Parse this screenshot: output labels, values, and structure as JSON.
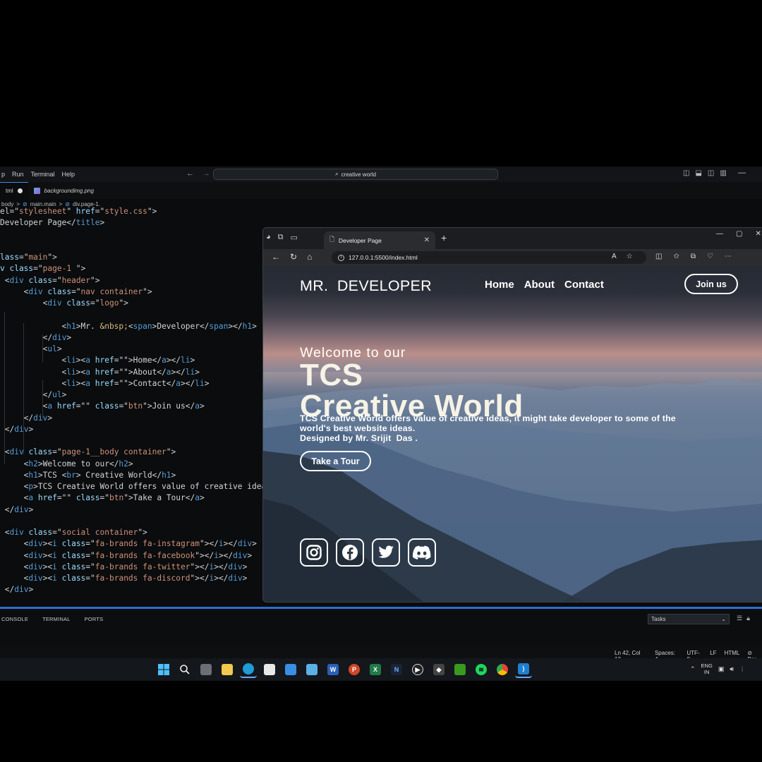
{
  "vscode": {
    "menus": [
      "p",
      "Run",
      "Terminal",
      "Help"
    ],
    "command_center": "creative world",
    "tabs": [
      {
        "label": "tml",
        "modified": true
      },
      {
        "label": "backgroundimg.png"
      }
    ],
    "breadcrumb": [
      "body",
      ">",
      "main.main",
      ">",
      "div.page-1."
    ],
    "panel_tabs": [
      "CONSOLE",
      "TERMINAL",
      "PORTS"
    ],
    "tasks_select": "Tasks",
    "status": {
      "position": "Ln 42, Col 12",
      "spaces": "Spaces: 4",
      "encoding": "UTF-8",
      "eol": "LF",
      "language": "HTML",
      "port": "Por"
    }
  },
  "browser": {
    "tab_title": "Developer Page",
    "url": "127.0.0.1:5500/index.html"
  },
  "site": {
    "logo_left": "MR.",
    "logo_right": "DEVELOPER",
    "nav": [
      "Home",
      "About",
      "Contact"
    ],
    "join_button": "Join us",
    "hero_subtitle": "Welcome to our",
    "hero_title_line1": "TCS",
    "hero_title_line2": "Creative World",
    "hero_paragraph_line1": "TCS Creative World offers value of creative ideas, it might take developer to some of the",
    "hero_paragraph_line2": "world's best website ideas.",
    "hero_paragraph_line3": "Designed by Mr. Srijit  Das .",
    "tour_button": "Take a Tour",
    "social_icons": [
      "instagram-icon",
      "facebook-icon",
      "twitter-icon",
      "discord-icon"
    ]
  },
  "taskbar": {
    "lang_line1": "ENG",
    "lang_line2": "IN"
  },
  "code_lines": [
    [
      [
        "p",
        "el=\""
      ],
      [
        "s",
        "stylesheet"
      ],
      [
        "p",
        "\" "
      ],
      [
        "a",
        "href"
      ],
      [
        "p",
        "=\""
      ],
      [
        "s",
        "style.css"
      ],
      [
        "p",
        "\">"
      ]
    ],
    [
      [
        "p",
        "Developer Page</"
      ],
      [
        "t",
        "title"
      ],
      [
        "p",
        ">"
      ]
    ],
    [],
    [],
    [
      [
        "a",
        "lass"
      ],
      [
        "p",
        "=\""
      ],
      [
        "s",
        "main"
      ],
      [
        "p",
        "\">"
      ]
    ],
    [
      [
        "a",
        "v class"
      ],
      [
        "p",
        "=\""
      ],
      [
        "s",
        "page-1 "
      ],
      [
        "p",
        "\">"
      ]
    ],
    [
      [
        "p",
        " <"
      ],
      [
        "t",
        "div"
      ],
      [
        "a",
        " class"
      ],
      [
        "p",
        "=\""
      ],
      [
        "s",
        "header"
      ],
      [
        "p",
        "\">"
      ]
    ],
    [
      [
        "p",
        "     <"
      ],
      [
        "t",
        "div"
      ],
      [
        "a",
        " class"
      ],
      [
        "p",
        "=\""
      ],
      [
        "s",
        "nav container"
      ],
      [
        "p",
        "\">"
      ]
    ],
    [
      [
        "p",
        "         <"
      ],
      [
        "t",
        "div"
      ],
      [
        "a",
        " class"
      ],
      [
        "p",
        "=\""
      ],
      [
        "s",
        "logo"
      ],
      [
        "p",
        "\">"
      ]
    ],
    [],
    [
      [
        "p",
        "             <"
      ],
      [
        "t",
        "h1"
      ],
      [
        "p",
        ">Mr. "
      ],
      [
        "e",
        "&nbsp;"
      ],
      [
        "p",
        "<"
      ],
      [
        "t",
        "span"
      ],
      [
        "p",
        ">Developer</"
      ],
      [
        "t",
        "span"
      ],
      [
        "p",
        "></"
      ],
      [
        "t",
        "h1"
      ],
      [
        "p",
        ">"
      ]
    ],
    [
      [
        "p",
        "         </"
      ],
      [
        "t",
        "div"
      ],
      [
        "p",
        ">"
      ]
    ],
    [
      [
        "p",
        "         <"
      ],
      [
        "t",
        "ul"
      ],
      [
        "p",
        ">"
      ]
    ],
    [
      [
        "p",
        "             <"
      ],
      [
        "t",
        "li"
      ],
      [
        "p",
        "><"
      ],
      [
        "t",
        "a"
      ],
      [
        "a",
        " href"
      ],
      [
        "p",
        "=\"\">Home</"
      ],
      [
        "t",
        "a"
      ],
      [
        "p",
        "></"
      ],
      [
        "t",
        "li"
      ],
      [
        "p",
        ">"
      ]
    ],
    [
      [
        "p",
        "             <"
      ],
      [
        "t",
        "li"
      ],
      [
        "p",
        "><"
      ],
      [
        "t",
        "a"
      ],
      [
        "a",
        " href"
      ],
      [
        "p",
        "=\"\">About</"
      ],
      [
        "t",
        "a"
      ],
      [
        "p",
        "></"
      ],
      [
        "t",
        "li"
      ],
      [
        "p",
        ">"
      ]
    ],
    [
      [
        "p",
        "             <"
      ],
      [
        "t",
        "li"
      ],
      [
        "p",
        "><"
      ],
      [
        "t",
        "a"
      ],
      [
        "a",
        " href"
      ],
      [
        "p",
        "=\"\">Contact</"
      ],
      [
        "t",
        "a"
      ],
      [
        "p",
        "></"
      ],
      [
        "t",
        "li"
      ],
      [
        "p",
        ">"
      ]
    ],
    [
      [
        "p",
        "         </"
      ],
      [
        "t",
        "ul"
      ],
      [
        "p",
        ">"
      ]
    ],
    [
      [
        "p",
        "         <"
      ],
      [
        "t",
        "a"
      ],
      [
        "a",
        " href"
      ],
      [
        "p",
        "=\"\" "
      ],
      [
        "a",
        "class"
      ],
      [
        "p",
        "=\""
      ],
      [
        "s",
        "btn"
      ],
      [
        "p",
        "\">Join us</"
      ],
      [
        "t",
        "a"
      ],
      [
        "p",
        ">"
      ]
    ],
    [
      [
        "p",
        "     </"
      ],
      [
        "t",
        "div"
      ],
      [
        "p",
        ">"
      ]
    ],
    [
      [
        "p",
        " </"
      ],
      [
        "t",
        "div"
      ],
      [
        "p",
        ">"
      ]
    ],
    [],
    [
      [
        "p",
        " <"
      ],
      [
        "t",
        "div"
      ],
      [
        "a",
        " class"
      ],
      [
        "p",
        "=\""
      ],
      [
        "s",
        "page-1__body container"
      ],
      [
        "p",
        "\">"
      ]
    ],
    [
      [
        "p",
        "     <"
      ],
      [
        "t",
        "h2"
      ],
      [
        "p",
        ">Welcome to our</"
      ],
      [
        "t",
        "h2"
      ],
      [
        "p",
        ">"
      ]
    ],
    [
      [
        "p",
        "     <"
      ],
      [
        "t",
        "h1"
      ],
      [
        "p",
        ">TCS <"
      ],
      [
        "t",
        "br"
      ],
      [
        "p",
        "> Creative World</"
      ],
      [
        "t",
        "h1"
      ],
      [
        "p",
        ">"
      ]
    ],
    [
      [
        "p",
        "     <"
      ],
      [
        "t",
        "p"
      ],
      [
        "p",
        ">TCS Creative World offers value of creative idea"
      ]
    ],
    [
      [
        "p",
        "     <"
      ],
      [
        "t",
        "a"
      ],
      [
        "a",
        " href"
      ],
      [
        "p",
        "=\"\" "
      ],
      [
        "a",
        "class"
      ],
      [
        "p",
        "=\""
      ],
      [
        "s",
        "btn"
      ],
      [
        "p",
        "\">Take a Tour</"
      ],
      [
        "t",
        "a"
      ],
      [
        "p",
        ">"
      ]
    ],
    [
      [
        "p",
        " </"
      ],
      [
        "t",
        "div"
      ],
      [
        "p",
        ">"
      ]
    ],
    [],
    [
      [
        "p",
        " <"
      ],
      [
        "t",
        "div"
      ],
      [
        "a",
        " class"
      ],
      [
        "p",
        "=\""
      ],
      [
        "s",
        "social container"
      ],
      [
        "p",
        "\">"
      ]
    ],
    [
      [
        "p",
        "     <"
      ],
      [
        "t",
        "div"
      ],
      [
        "p",
        "><"
      ],
      [
        "t",
        "i"
      ],
      [
        "a",
        " class"
      ],
      [
        "p",
        "=\""
      ],
      [
        "s",
        "fa-brands fa-instagram"
      ],
      [
        "p",
        "\"></"
      ],
      [
        "t",
        "i"
      ],
      [
        "p",
        "></"
      ],
      [
        "t",
        "div"
      ],
      [
        "p",
        ">"
      ]
    ],
    [
      [
        "p",
        "     <"
      ],
      [
        "t",
        "div"
      ],
      [
        "p",
        "><"
      ],
      [
        "t",
        "i"
      ],
      [
        "a",
        " class"
      ],
      [
        "p",
        "=\""
      ],
      [
        "s",
        "fa-brands fa-facebook"
      ],
      [
        "p",
        "\"></"
      ],
      [
        "t",
        "i"
      ],
      [
        "p",
        "></"
      ],
      [
        "t",
        "div"
      ],
      [
        "p",
        ">"
      ]
    ],
    [
      [
        "p",
        "     <"
      ],
      [
        "t",
        "div"
      ],
      [
        "p",
        "><"
      ],
      [
        "t",
        "i"
      ],
      [
        "a",
        " class"
      ],
      [
        "p",
        "=\""
      ],
      [
        "s",
        "fa-brands fa-twitter"
      ],
      [
        "p",
        "\"></"
      ],
      [
        "t",
        "i"
      ],
      [
        "p",
        "></"
      ],
      [
        "t",
        "div"
      ],
      [
        "p",
        ">"
      ]
    ],
    [
      [
        "p",
        "     <"
      ],
      [
        "t",
        "div"
      ],
      [
        "p",
        "><"
      ],
      [
        "t",
        "i"
      ],
      [
        "a",
        " class"
      ],
      [
        "p",
        "=\""
      ],
      [
        "s",
        "fa-brands fa-discord"
      ],
      [
        "p",
        "\"></"
      ],
      [
        "t",
        "i"
      ],
      [
        "p",
        "></"
      ],
      [
        "t",
        "div"
      ],
      [
        "p",
        ">"
      ]
    ],
    [
      [
        "p",
        " </"
      ],
      [
        "t",
        "div"
      ],
      [
        "p",
        ">"
      ]
    ]
  ]
}
